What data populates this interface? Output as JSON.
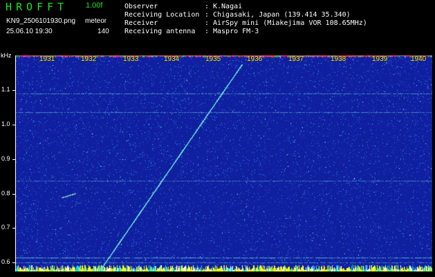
{
  "app": {
    "title": "HROFFT",
    "version": "1.00f"
  },
  "file": {
    "name": "KN9_2506101930.png",
    "meta": "meteor",
    "datetime": "25.06.10 19:30",
    "count": "140"
  },
  "header": [
    {
      "key": "Observer",
      "value": "K.Nagai"
    },
    {
      "key": "Receiving Location",
      "value": "Chigasaki, Japan (139.414 35.340)"
    },
    {
      "key": "Receiver",
      "value": "AirSpy mini (Miakejima VOR 108.65MHz)"
    },
    {
      "key": "Receiving antenna",
      "value": "Maspro FM-3"
    }
  ],
  "axis": {
    "unit": "kHz",
    "y_labels": [
      "1.1",
      "1.0",
      "0.9",
      "0.8",
      "0.7",
      "0.6"
    ],
    "x_labels": [
      "1931",
      "1932",
      "1933",
      "1934",
      "1935",
      "1936",
      "1937",
      "1938",
      "1939",
      "1940"
    ]
  },
  "colors": {
    "background": "#0f1f9e",
    "title": "#19e619",
    "time_labels": "#ffea00"
  }
}
